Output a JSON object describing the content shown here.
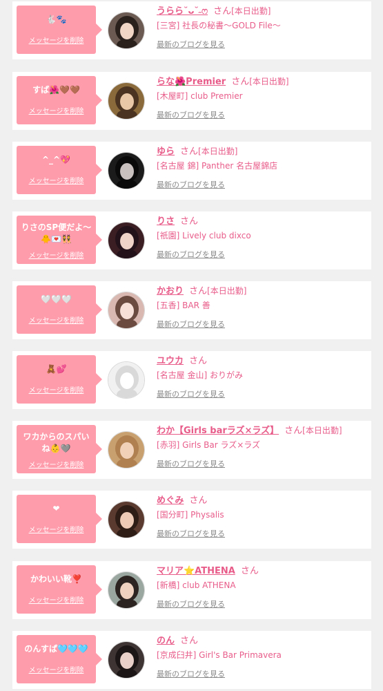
{
  "delete_label": "メッセージを削除",
  "blog_label": "最新のブログを見る",
  "san_label": "さん",
  "work_label": "[本日出勤]",
  "colors": {
    "bubble": "#ff9cac",
    "accent": "#e85c8a",
    "muted": "#8a8a8a",
    "background": "#f0f0f0"
  },
  "messages": [
    {
      "message": "🐇🐾",
      "name": "うらら˘ᴗ˘˶ෆ",
      "working": true,
      "shop": "[三宮] 社長の秘書〜GOLD File〜"
    },
    {
      "message": "すば🌺🤎🤎",
      "name": "らな🌺Premier",
      "working": true,
      "shop": "[木屋町] club Premier"
    },
    {
      "message": "^_^💖",
      "name": "ゆら",
      "working": true,
      "shop": "[名古屋 錦] Panther 名古屋錦店"
    },
    {
      "message": "りさのSP便だよ〜🐥💌👯",
      "name": "りさ",
      "working": false,
      "shop": "[祇園] Lively club dixco"
    },
    {
      "message": "🤍🤍🤍",
      "name": "かおり",
      "working": true,
      "shop": "[五香] BAR 善"
    },
    {
      "message": "🧸💕",
      "name": "ユウカ",
      "working": false,
      "shop": "[名古屋 金山] おりがみ"
    },
    {
      "message": "ワカからのスパいね👶🩶",
      "name": "わか【Girls barラズ×ラズ】",
      "working": true,
      "shop": "[赤羽] Girls Bar ラズ×ラズ"
    },
    {
      "message": "❤",
      "name": "めぐみ",
      "working": false,
      "shop": "[国分町] Physalis"
    },
    {
      "message": "かわいい靴❣️",
      "name": "マリア⭐ATHENA",
      "working": false,
      "shop": "[新橋] club ATHENA"
    },
    {
      "message": "のんすぱ🩵🩵🩵",
      "name": "のん",
      "working": false,
      "shop": "[京成臼井] Girl's Bar Primavera"
    }
  ]
}
